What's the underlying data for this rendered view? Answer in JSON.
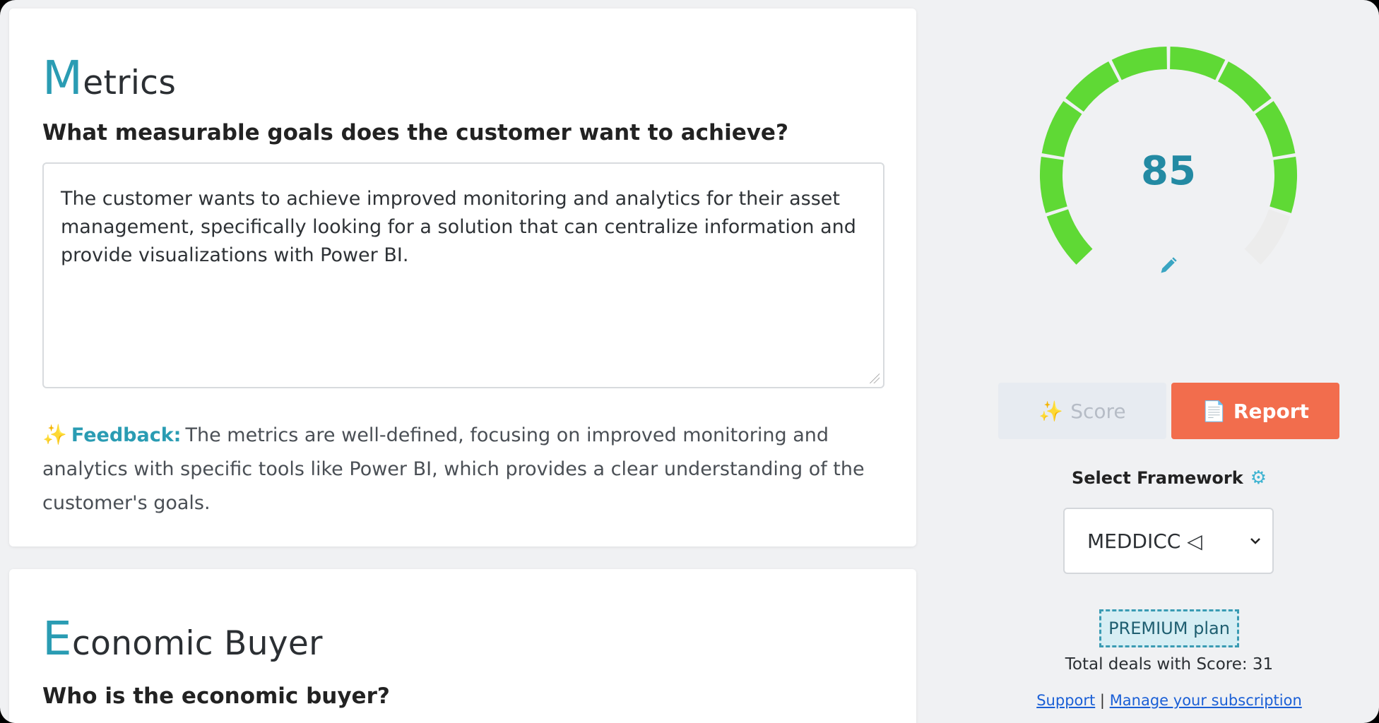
{
  "metrics": {
    "title_initial": "M",
    "title_rest": "etrics",
    "question": "What measurable goals does the customer want to achieve?",
    "answer": "The customer wants to achieve improved monitoring and analytics for their asset management, specifically looking for a solution that can centralize information and provide visualizations with Power BI.",
    "feedback_icon": "✨",
    "feedback_label": "Feedback:",
    "feedback_text": "The metrics are well-defined, focusing on improved monitoring and analytics with specific tools like Power BI, which provides a clear understanding of the customer's goals."
  },
  "economic_buyer": {
    "title_initial": "E",
    "title_rest": "conomic Buyer",
    "question": "Who is the economic buyer?"
  },
  "gauge": {
    "score": "85",
    "segments_total": 10,
    "segments_filled": 9,
    "filled_color": "#5fd935",
    "empty_color": "#ececec"
  },
  "buttons": {
    "score_icon": "✨",
    "score_label": "Score",
    "report_icon": "📄",
    "report_label": "Report"
  },
  "framework": {
    "label": "Select Framework",
    "selected": "MEDDICC ◁"
  },
  "plan": {
    "badge": "PREMIUM plan",
    "total_deals": "Total deals with Score: 31",
    "support_link": "Support",
    "separator": "|",
    "manage_link": "Manage your subscription"
  },
  "colors": {
    "accent": "#2a9cb3",
    "report_button": "#f26d4d",
    "link": "#1a5fd6"
  }
}
